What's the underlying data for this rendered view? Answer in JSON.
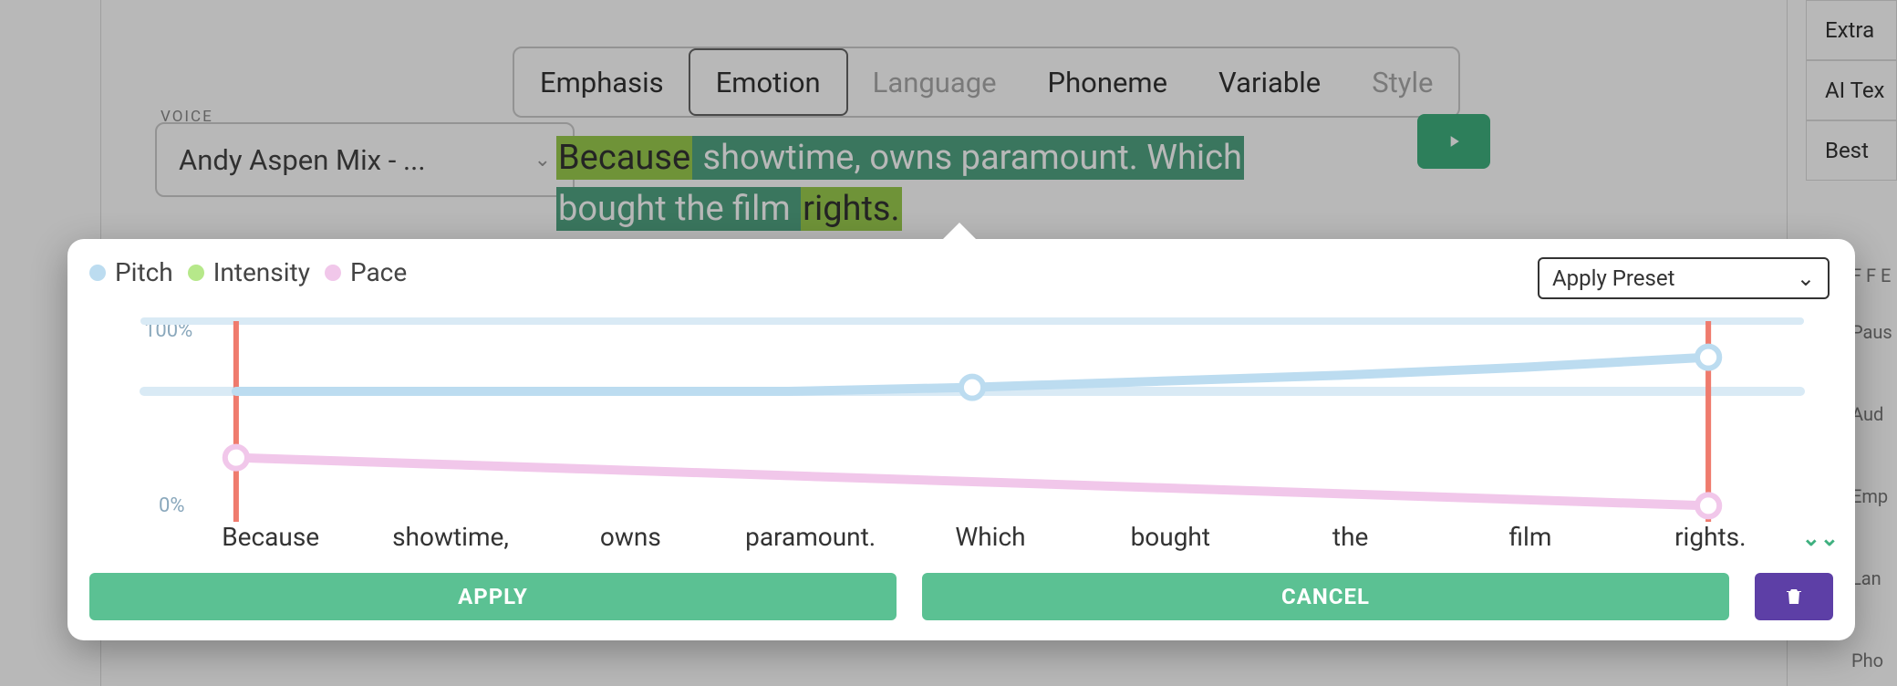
{
  "voice": {
    "label": "VOICE",
    "selected": "Andy Aspen Mix - ..."
  },
  "tabs": [
    {
      "id": "emphasis",
      "label": "Emphasis",
      "active": false,
      "disabled": false
    },
    {
      "id": "emotion",
      "label": "Emotion",
      "active": true,
      "disabled": false
    },
    {
      "id": "language",
      "label": "Language",
      "active": false,
      "disabled": true
    },
    {
      "id": "phoneme",
      "label": "Phoneme",
      "active": false,
      "disabled": false
    },
    {
      "id": "variable",
      "label": "Variable",
      "active": false,
      "disabled": false
    },
    {
      "id": "style",
      "label": "Style",
      "active": false,
      "disabled": true
    }
  ],
  "sentence_segments": [
    {
      "text": "Because",
      "style": "seg-green-lt"
    },
    {
      "text": " showtime, owns paramount. Which",
      "style": "seg-teal"
    },
    {
      "text": " bought the film ",
      "style": "seg-teal"
    },
    {
      "text": "rights.",
      "style": "seg-green-lt"
    }
  ],
  "side_cards": [
    "Extra",
    "AI Tex",
    "Best"
  ],
  "side_truncated": [
    "F F E",
    "Paus",
    "Aud",
    "Emp",
    "Lan",
    "Pho"
  ],
  "popover": {
    "legend": {
      "pitch": "Pitch",
      "intensity": "Intensity",
      "pace": "Pace"
    },
    "preset_label": "Apply Preset",
    "y_max": "100%",
    "y_min": "0%",
    "words": [
      "Because",
      "showtime,",
      "owns",
      "paramount.",
      "Which",
      "bought",
      "the",
      "film",
      "rights."
    ],
    "buttons": {
      "apply": "APPLY",
      "cancel": "CANCEL"
    }
  },
  "chart_data": {
    "type": "line",
    "xlabel": "",
    "ylabel": "",
    "ylim": [
      0,
      100
    ],
    "x": [
      "Because",
      "showtime,",
      "owns",
      "paramount.",
      "Which",
      "bought",
      "the",
      "film",
      "rights."
    ],
    "series": [
      {
        "name": "Pitch",
        "color": "#bcdcf0",
        "values": [
          65,
          65,
          65,
          65,
          67,
          70,
          73,
          77,
          82
        ]
      },
      {
        "name": "Intensity",
        "color": "#b6e88a",
        "values": [
          null,
          null,
          null,
          null,
          null,
          null,
          null,
          null,
          null
        ]
      },
      {
        "name": "Pace",
        "color": "#f1c7ea",
        "values": [
          32,
          29,
          26,
          23,
          20,
          17,
          14,
          11,
          8
        ]
      }
    ],
    "boundary_markers_x_index": [
      0,
      8
    ],
    "control_points": [
      {
        "series": "Pitch",
        "x_index": 4,
        "value": 67
      },
      {
        "series": "Pitch",
        "x_index": 8,
        "value": 82
      },
      {
        "series": "Pace",
        "x_index": 0,
        "value": 32
      },
      {
        "series": "Pace",
        "x_index": 8,
        "value": 8
      }
    ]
  }
}
